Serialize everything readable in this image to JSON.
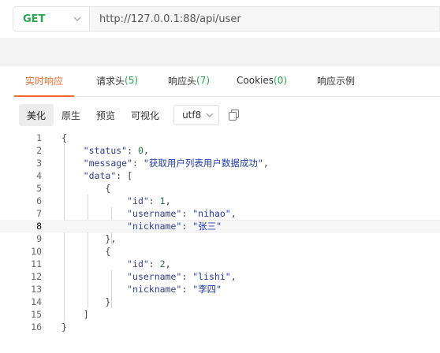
{
  "request": {
    "method": "GET",
    "url": "http://127.0.0.1:88/api/user"
  },
  "response_tabs": [
    {
      "label": "实时响应",
      "count": ""
    },
    {
      "label": "请求头",
      "count": "(5)"
    },
    {
      "label": "响应头",
      "count": "(7)"
    },
    {
      "label": "Cookies",
      "count": "(0)"
    },
    {
      "label": "响应示例",
      "count": ""
    }
  ],
  "view_modes": [
    "美化",
    "原生",
    "预览",
    "可视化"
  ],
  "encoding": "utf8",
  "icons": {
    "method_dropdown": "chevron-down-icon",
    "encoding_dropdown": "chevron-down-icon",
    "copy": "copy-icon"
  },
  "colors": {
    "accent": "#f06b2c",
    "method": "#2ba44f",
    "count": "#2ba44f"
  },
  "code": {
    "line_numbers": [
      "1",
      "2",
      "3",
      "4",
      "5",
      "6",
      "7",
      "8",
      "9",
      "10",
      "11",
      "12",
      "13",
      "14",
      "15",
      "16"
    ],
    "current_line": "8",
    "lines": [
      "{",
      "    \"status\": 0,",
      "    \"message\": \"获取用户列表用户数据成功\",",
      "    \"data\": [",
      "        {",
      "            \"id\": 1,",
      "            \"username\": \"nihao\",",
      "            \"nickname\": \"张三\"",
      "        },",
      "        {",
      "            \"id\": 2,",
      "            \"username\": \"lishi\",",
      "            \"nickname\": \"李四\"",
      "        }",
      "    ]",
      "}"
    ]
  }
}
